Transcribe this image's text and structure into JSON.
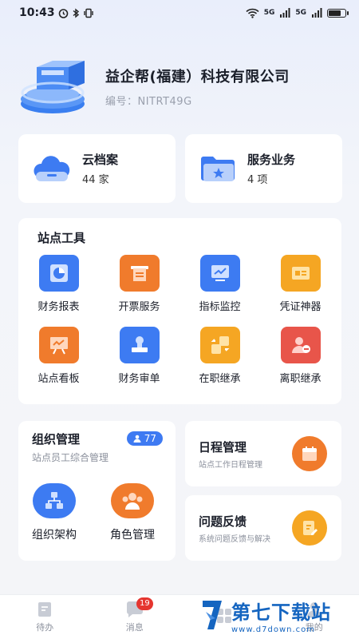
{
  "status_bar": {
    "time": "10:43",
    "network_1": "5G",
    "network_2": "5G"
  },
  "company": {
    "name": "益企帮(福建）科技有限公司",
    "code": "编号：NITRT49G"
  },
  "stats": [
    {
      "title": "云档案",
      "count": "44 家",
      "icon": "cloud-icon"
    },
    {
      "title": "服务业务",
      "count": "4 项",
      "icon": "folder-star-icon"
    }
  ],
  "tools": {
    "title": "站点工具",
    "items": [
      {
        "label": "财务报表",
        "icon": "pie-chart-icon",
        "color": "#3d7bf2"
      },
      {
        "label": "开票服务",
        "icon": "invoice-icon",
        "color": "#f07b2c"
      },
      {
        "label": "指标监控",
        "icon": "monitor-trend-icon",
        "color": "#3d7bf2"
      },
      {
        "label": "凭证神器",
        "icon": "voucher-icon",
        "color": "#f5a623"
      },
      {
        "label": "站点看板",
        "icon": "board-icon",
        "color": "#f07b2c"
      },
      {
        "label": "财务审单",
        "icon": "stamp-icon",
        "color": "#3d7bf2"
      },
      {
        "label": "在职继承",
        "icon": "transfer-icon",
        "color": "#f5a623"
      },
      {
        "label": "离职继承",
        "icon": "user-leave-icon",
        "color": "#e8554a"
      }
    ]
  },
  "org": {
    "title": "组织管理",
    "badge": "77",
    "subtitle": "站点员工综合管理",
    "items": [
      {
        "label": "组织架构",
        "icon": "org-chart-icon",
        "color": "#3d7bf2"
      },
      {
        "label": "角色管理",
        "icon": "roles-icon",
        "color": "#f07b2c"
      }
    ]
  },
  "schedule": {
    "title": "日程管理",
    "subtitle": "站点工作日程管理",
    "icon": "calendar-icon",
    "color": "#f07b2c"
  },
  "feedback": {
    "title": "问题反馈",
    "subtitle": "系统问题反馈与解决",
    "icon": "edit-note-icon",
    "color": "#f5a623"
  },
  "nav": {
    "items": [
      {
        "label": "待办",
        "icon": "todo-icon"
      },
      {
        "label": "消息",
        "icon": "message-icon",
        "badge": "19"
      },
      {
        "label": "",
        "icon": "workbench-icon"
      },
      {
        "label": "我的",
        "icon": "user-icon"
      }
    ]
  },
  "watermark": {
    "title": "第七下载站",
    "url": "www.d7down.com"
  }
}
